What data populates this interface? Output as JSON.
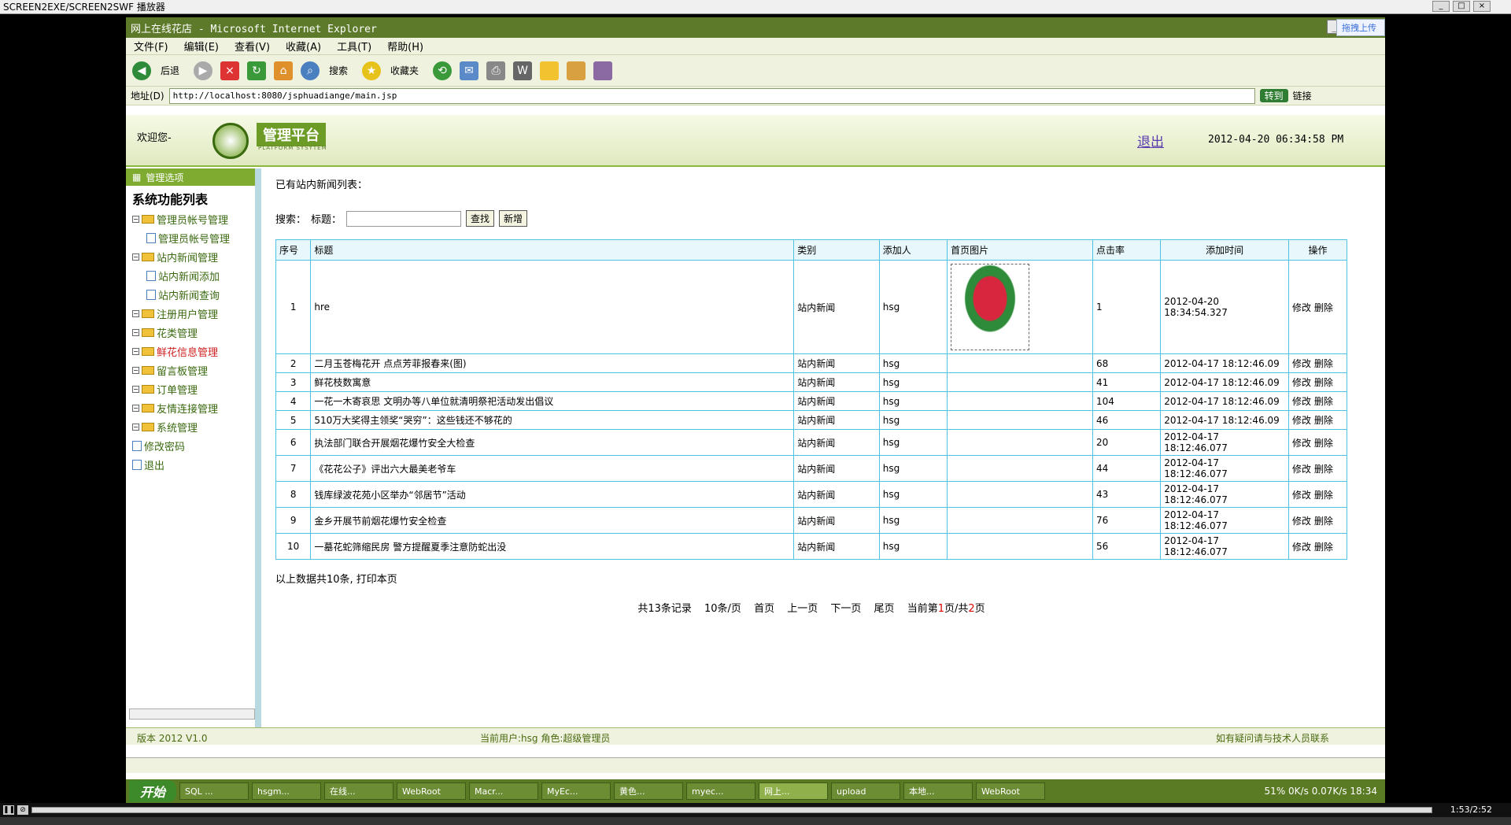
{
  "player": {
    "title": "SCREEN2EXE/SCREEN2SWF 播放器",
    "time": "1:53/2:52"
  },
  "ie": {
    "title": "网上在线花店 - Microsoft Internet Explorer",
    "upload": "拖拽上传",
    "menu": [
      "文件(F)",
      "编辑(E)",
      "查看(V)",
      "收藏(A)",
      "工具(T)",
      "帮助(H)"
    ],
    "toolbar": {
      "back": "后退",
      "search": "搜索",
      "favorites": "收藏夹"
    },
    "address_label": "地址(D)",
    "url": "http://localhost:8080/jsphuadiange/main.jsp",
    "go": "转到",
    "links": "链接"
  },
  "header": {
    "welcome": "欢迎您-",
    "logo": "管理平台",
    "logo_sub": "PLATFORM SYSYTEM",
    "logout": "退出",
    "datetime": "2012-04-20 06:34:58 PM"
  },
  "sidebar": {
    "head": "管理选项",
    "title": "系统功能列表",
    "items": [
      {
        "label": "管理员帐号管理",
        "level": 0,
        "kind": "folder",
        "red": false
      },
      {
        "label": "管理员帐号管理",
        "level": 1,
        "kind": "doc",
        "red": false
      },
      {
        "label": "站内新闻管理",
        "level": 0,
        "kind": "folder",
        "red": false
      },
      {
        "label": "站内新闻添加",
        "level": 1,
        "kind": "doc",
        "red": false
      },
      {
        "label": "站内新闻查询",
        "level": 1,
        "kind": "doc",
        "red": false
      },
      {
        "label": "注册用户管理",
        "level": 0,
        "kind": "folder",
        "red": false
      },
      {
        "label": "花类管理",
        "level": 0,
        "kind": "folder",
        "red": false
      },
      {
        "label": "鲜花信息管理",
        "level": 0,
        "kind": "folder",
        "red": true
      },
      {
        "label": "留言板管理",
        "level": 0,
        "kind": "folder",
        "red": false
      },
      {
        "label": "订单管理",
        "level": 0,
        "kind": "folder",
        "red": false
      },
      {
        "label": "友情连接管理",
        "level": 0,
        "kind": "folder",
        "red": false
      },
      {
        "label": "系统管理",
        "level": 0,
        "kind": "folder",
        "red": false
      },
      {
        "label": "修改密码",
        "level": 0,
        "kind": "doc",
        "red": false
      },
      {
        "label": "退出",
        "level": 0,
        "kind": "doc",
        "red": false
      }
    ]
  },
  "content": {
    "caption": "已有站内新闻列表：",
    "search_label": "搜索：",
    "title_label": "标题：",
    "search_btn": "查找",
    "add_btn": "新增",
    "columns": [
      "序号",
      "标题",
      "类别",
      "添加人",
      "首页图片",
      "点击率",
      "添加时间",
      "操作"
    ],
    "edit": "修改",
    "del": "删除",
    "rows": [
      {
        "no": "1",
        "title": "hre",
        "type": "站内新闻",
        "author": "hsg",
        "image": true,
        "clicks": "1",
        "time": "2012-04-20 18:34:54.327"
      },
      {
        "no": "2",
        "title": "二月玉苍梅花开 点点芳菲报春来(图)",
        "type": "站内新闻",
        "author": "hsg",
        "image": false,
        "clicks": "68",
        "time": "2012-04-17 18:12:46.09"
      },
      {
        "no": "3",
        "title": "鲜花枝数寓意",
        "type": "站内新闻",
        "author": "hsg",
        "image": false,
        "clicks": "41",
        "time": "2012-04-17 18:12:46.09"
      },
      {
        "no": "4",
        "title": "一花一木寄哀思 文明办等八单位就清明祭祀活动发出倡议",
        "type": "站内新闻",
        "author": "hsg",
        "image": false,
        "clicks": "104",
        "time": "2012-04-17 18:12:46.09"
      },
      {
        "no": "5",
        "title": "510万大奖得主领奖“哭穷”：这些钱还不够花的",
        "type": "站内新闻",
        "author": "hsg",
        "image": false,
        "clicks": "46",
        "time": "2012-04-17 18:12:46.09"
      },
      {
        "no": "6",
        "title": "执法部门联合开展烟花爆竹安全大检查",
        "type": "站内新闻",
        "author": "hsg",
        "image": false,
        "clicks": "20",
        "time": "2012-04-17 18:12:46.077"
      },
      {
        "no": "7",
        "title": "《花花公子》评出六大最美老爷车",
        "type": "站内新闻",
        "author": "hsg",
        "image": false,
        "clicks": "44",
        "time": "2012-04-17 18:12:46.077"
      },
      {
        "no": "8",
        "title": "钱库绿波花苑小区举办“邻居节”活动",
        "type": "站内新闻",
        "author": "hsg",
        "image": false,
        "clicks": "43",
        "time": "2012-04-17 18:12:46.077"
      },
      {
        "no": "9",
        "title": "金乡开展节前烟花爆竹安全检查",
        "type": "站内新闻",
        "author": "hsg",
        "image": false,
        "clicks": "76",
        "time": "2012-04-17 18:12:46.077"
      },
      {
        "no": "10",
        "title": "一墓花蛇筛缩民房 警方提醒夏季注意防蛇出没",
        "type": "站内新闻",
        "author": "hsg",
        "image": false,
        "clicks": "56",
        "time": "2012-04-17 18:12:46.077"
      }
    ],
    "summary": "以上数据共10条, 打印本页",
    "pager": {
      "total": "共13条记录",
      "per_page": "10条/页",
      "first": "首页",
      "prev": "上一页",
      "next": "下一页",
      "last": "尾页",
      "current_prefix": "当前第",
      "current_page": "1",
      "current_mid": "页/共",
      "total_pages": "2",
      "current_suffix": "页"
    }
  },
  "footer": {
    "version": "版本 2012 V1.0",
    "user": "当前用户:hsg  角色:超级管理员",
    "contact": "如有疑问请与技术人员联系"
  },
  "taskbar": {
    "start": "开始",
    "tasks": [
      "SQL ...",
      "hsgm...",
      "在线...",
      "WebRoot",
      "Macr...",
      "MyEc...",
      "黄色...",
      "myec...",
      "网上...",
      "upload",
      "本地...",
      "WebRoot"
    ],
    "active_index": 8,
    "clock": "18:34",
    "net": "51%",
    "net_up": "0K/s",
    "net_down": "0.07K/s"
  }
}
